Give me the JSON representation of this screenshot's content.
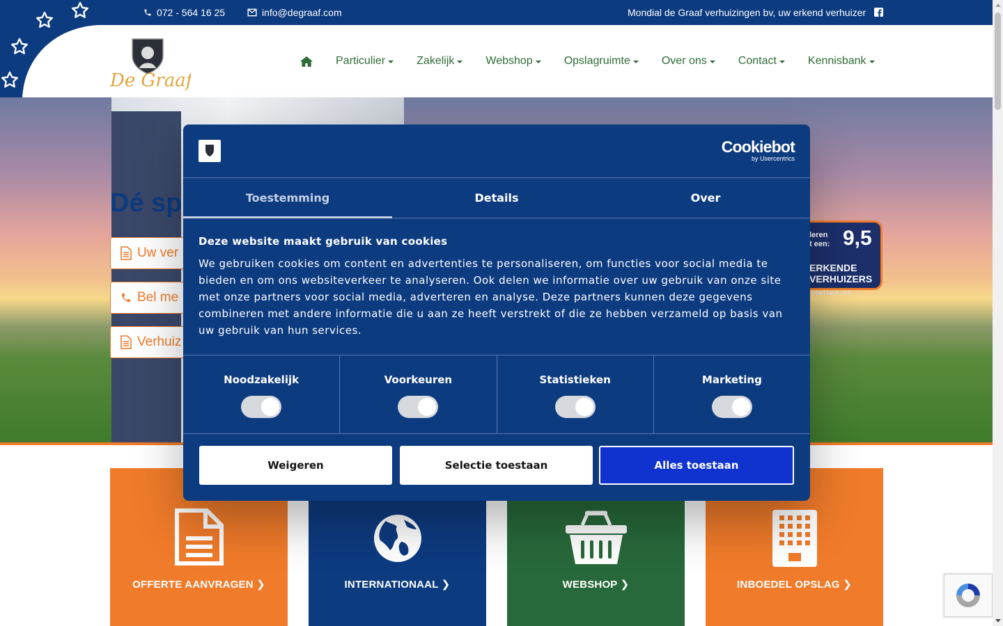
{
  "topbar": {
    "phone": "072 - 564 16 25",
    "email": "info@degraaf.com",
    "tagline": "Mondial de Graaf verhuizingen bv, uw erkend verhuizer",
    "phone_icon": "phone-icon",
    "email_icon": "envelope-icon",
    "social_icon": "facebook-icon"
  },
  "header": {
    "logo_text": "De Graaf",
    "home_icon": "home-icon",
    "nav": [
      {
        "label": "Particulier"
      },
      {
        "label": "Zakelijk"
      },
      {
        "label": "Webshop"
      },
      {
        "label": "Opslagruimte"
      },
      {
        "label": "Over ons"
      },
      {
        "label": "Contact"
      },
      {
        "label": "Kennisbank"
      }
    ]
  },
  "hero": {
    "title": "Dé sp",
    "buttons": [
      {
        "label": "Uw ver",
        "icon": "document-icon"
      },
      {
        "label": "Bel me",
        "icon": "phone-icon"
      },
      {
        "label": "Verhuiz",
        "icon": "document-icon"
      }
    ],
    "badge": {
      "small_line_1": "leren",
      "small_line_2": "t een:",
      "score": "9,5",
      "org_line_1": "ERKENDE",
      "org_line_2": "VERHUIZERS",
      "site": "rtellen.nl"
    }
  },
  "tiles": [
    {
      "label": "OFFERTE AANVRAGEN",
      "icon": "document-icon",
      "color": "#f07b2a"
    },
    {
      "label": "INTERNATIONAAL",
      "icon": "globe-icon",
      "color": "#0d3b80"
    },
    {
      "label": "WEBSHOP",
      "icon": "basket-icon",
      "color": "#27693a"
    },
    {
      "label": "INBOEDEL OPSLAG",
      "icon": "building-icon",
      "color": "#f07b2a"
    }
  ],
  "cookie": {
    "brand": "Cookiebot",
    "brand_sub": "by Usercentrics",
    "tabs": [
      {
        "label": "Toestemming",
        "active": true
      },
      {
        "label": "Details",
        "active": false
      },
      {
        "label": "Over",
        "active": false
      }
    ],
    "heading": "Deze website maakt gebruik van cookies",
    "text": "We gebruiken cookies om content en advertenties te personaliseren, om functies voor social media te bieden en om ons websiteverkeer te analyseren. Ook delen we informatie over uw gebruik van onze site met onze partners voor social media, adverteren en analyse. Deze partners kunnen deze gegevens combineren met andere informatie die u aan ze heeft verstrekt of die ze hebben verzameld op basis van uw gebruik van hun services.",
    "categories": [
      {
        "label": "Noodzakelijk",
        "enabled": true
      },
      {
        "label": "Voorkeuren",
        "enabled": true
      },
      {
        "label": "Statistieken",
        "enabled": true
      },
      {
        "label": "Marketing",
        "enabled": true
      }
    ],
    "buttons": {
      "reject": "Weigeren",
      "allow_selection": "Selectie toestaan",
      "allow_all": "Alles toestaan"
    }
  },
  "colors": {
    "brand_blue": "#0d3b80",
    "brand_orange": "#f07b2a",
    "brand_green": "#27693a",
    "cta_blue": "#1032cf"
  }
}
